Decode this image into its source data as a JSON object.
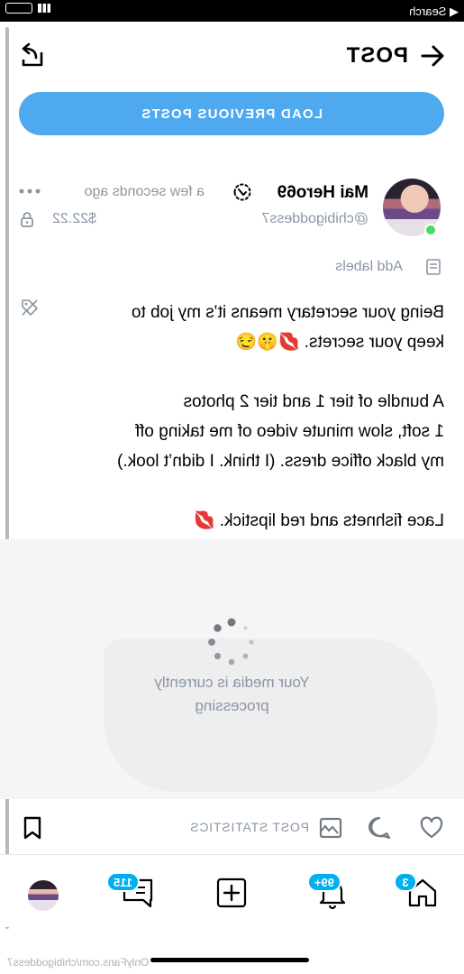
{
  "status_bar": {
    "back_label": "◀ Search"
  },
  "header": {
    "title": "POST"
  },
  "load_previous": "LOAD PREVIOUS POSTS",
  "post": {
    "author_name": "Mai Hero69",
    "time": "a few seconds ago",
    "handle": "@chibigoddess7",
    "price": "$22.22",
    "add_labels": "Add labels",
    "text": "Being your secretary means it’s my job to\nkeep your secrets. 💋🤫😏\n\nA bundle of tier 1 and tier 2 photos\n1 soft, slow minute video of me taking off\nmy black office dress. (I think. I didn’t look.)\n\nLace fishnets and red lipstick. 💋",
    "media_status": "Your media is currently processing",
    "stats_label": "POST STATISTICS"
  },
  "nav": {
    "home_badge": "3",
    "notifications_badge": "99+",
    "messages_badge": "115"
  },
  "footer": {
    "url": "OnlyFans.com/chibigoddess7"
  },
  "colors": {
    "accent": "#00aff0",
    "button": "#4ea9ee",
    "muted": "#8a96a3",
    "online": "#4cd964"
  }
}
